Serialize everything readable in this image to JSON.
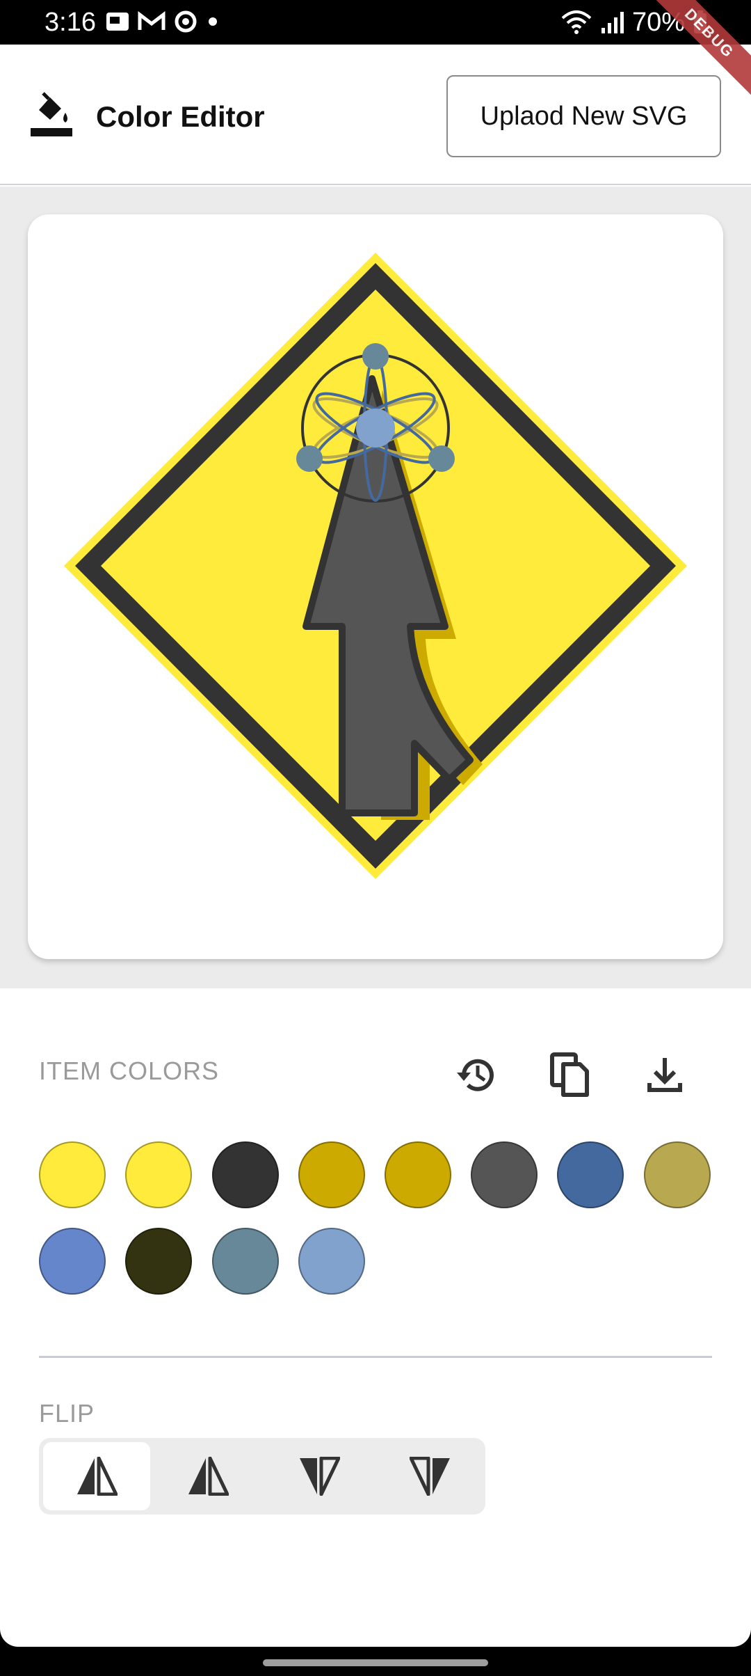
{
  "status_bar": {
    "time": "3:16",
    "battery": "70%"
  },
  "debug_banner": "DEBUG",
  "app_bar": {
    "title": "Color Editor",
    "upload_button": "Uplaod New SVG"
  },
  "item_colors": {
    "label": "ITEM COLORS",
    "swatches": [
      "#ffeb3b",
      "#ffeb3b",
      "#333333",
      "#ccaa00",
      "#ccaa00",
      "#555555",
      "#44699f",
      "#b8a850",
      "#6686cc",
      "#333311",
      "#668899",
      "#80a2cc"
    ]
  },
  "flip": {
    "label": "FLIP",
    "options": [
      "flip-none",
      "flip-horizontal",
      "flip-vertical",
      "flip-both"
    ],
    "selected_index": 0
  },
  "colors": {
    "sign_fill": "#ffeb3b",
    "sign_border": "#333333",
    "arrow_fill": "#555555",
    "arrow_shadow": "#ccaa00",
    "atom_core": "#80a2cc",
    "atom_electron": "#668899"
  }
}
